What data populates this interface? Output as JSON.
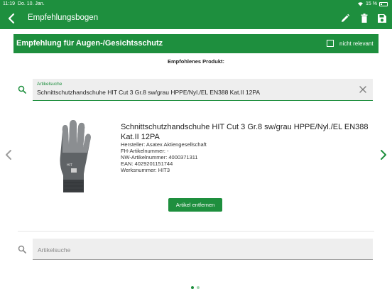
{
  "status_bar": {
    "time": "11:19",
    "date": "Do. 10. Jan.",
    "battery": "15 %"
  },
  "nav": {
    "title": "Empfehlungsbogen"
  },
  "section": {
    "title": "Empfehlung für Augen-/Gesichtsschutz",
    "not_relevant_label": "nicht relevant",
    "not_relevant_checked": false
  },
  "recommended_label": "Empfohlenes Produkt:",
  "search_selected": {
    "label": "Artikelsuche",
    "value": "Schnittschutzhandschuhe HIT Cut 3 Gr.8 sw/grau HPPE/Nyl./EL EN388 Kat.II 12PA"
  },
  "product": {
    "name": "Schnittschutzhandschuhe HIT Cut 3 Gr.8 sw/grau HPPE/Nyl./EL EN388 Kat.II 12PA",
    "manufacturer": "Hersteller: Asatex Aktiengesellschaft",
    "fh_number": "FH-Artikelnummer: -",
    "nw_number": "NW-Artikelnummer: 4000371311",
    "ean": "EAN: 4029201151744",
    "works_number": "Werksnummer: HIT3",
    "remove_button": "Artikel entfernen"
  },
  "search_empty": {
    "placeholder": "Artikelsuche"
  },
  "pagination": {
    "pages": 2,
    "current": 1
  },
  "colors": {
    "primary": "#1e8f3e",
    "dot_inactive": "#a5d6b3"
  }
}
